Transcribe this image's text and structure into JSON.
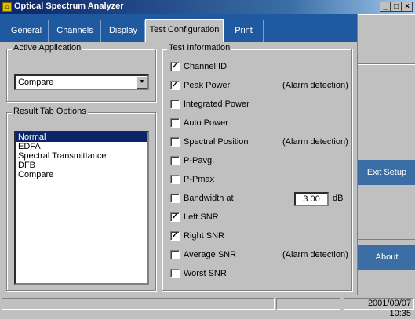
{
  "window": {
    "title": "Optical Spectrum Analyzer",
    "minimize": "_",
    "maximize": "□",
    "close": "×"
  },
  "tabs": [
    {
      "label": "General"
    },
    {
      "label": "Channels"
    },
    {
      "label": "Display"
    },
    {
      "label": "Test Configuration",
      "active": true
    },
    {
      "label": "Print"
    }
  ],
  "active_application": {
    "title": "Active Application",
    "value": "Compare"
  },
  "result_tab_options": {
    "title": "Result Tab Options",
    "items": [
      {
        "label": "Normal",
        "selected": true
      },
      {
        "label": "EDFA"
      },
      {
        "label": "Spectral Transmittance"
      },
      {
        "label": "DFB"
      },
      {
        "label": "Compare"
      }
    ]
  },
  "test_information": {
    "title": "Test Information",
    "items": [
      {
        "label": "Channel ID",
        "checked": true
      },
      {
        "label": "Peak Power",
        "checked": true,
        "note": "(Alarm detection)"
      },
      {
        "label": "Integrated Power",
        "checked": false
      },
      {
        "label": "Auto Power",
        "checked": false
      },
      {
        "label": "Spectral Position",
        "checked": false,
        "note": "(Alarm detection)"
      },
      {
        "label": "P-Pavg.",
        "checked": false
      },
      {
        "label": "P-Pmax",
        "checked": false
      },
      {
        "label": "Bandwidth at",
        "checked": false,
        "value": "3.00",
        "unit": "dB"
      },
      {
        "label": "Left SNR",
        "checked": true
      },
      {
        "label": "Right SNR",
        "checked": true
      },
      {
        "label": "Average SNR",
        "checked": false,
        "note": "(Alarm detection)"
      },
      {
        "label": "Worst SNR",
        "checked": false
      }
    ]
  },
  "right_panel": {
    "exit_setup": "Exit Setup",
    "about": "About"
  },
  "status": {
    "datetime": "2001/09/07 10:35"
  },
  "colors": {
    "tab_bar": "#1f5aa0",
    "button": "#3a6ea5",
    "selection": "#0a246a"
  }
}
